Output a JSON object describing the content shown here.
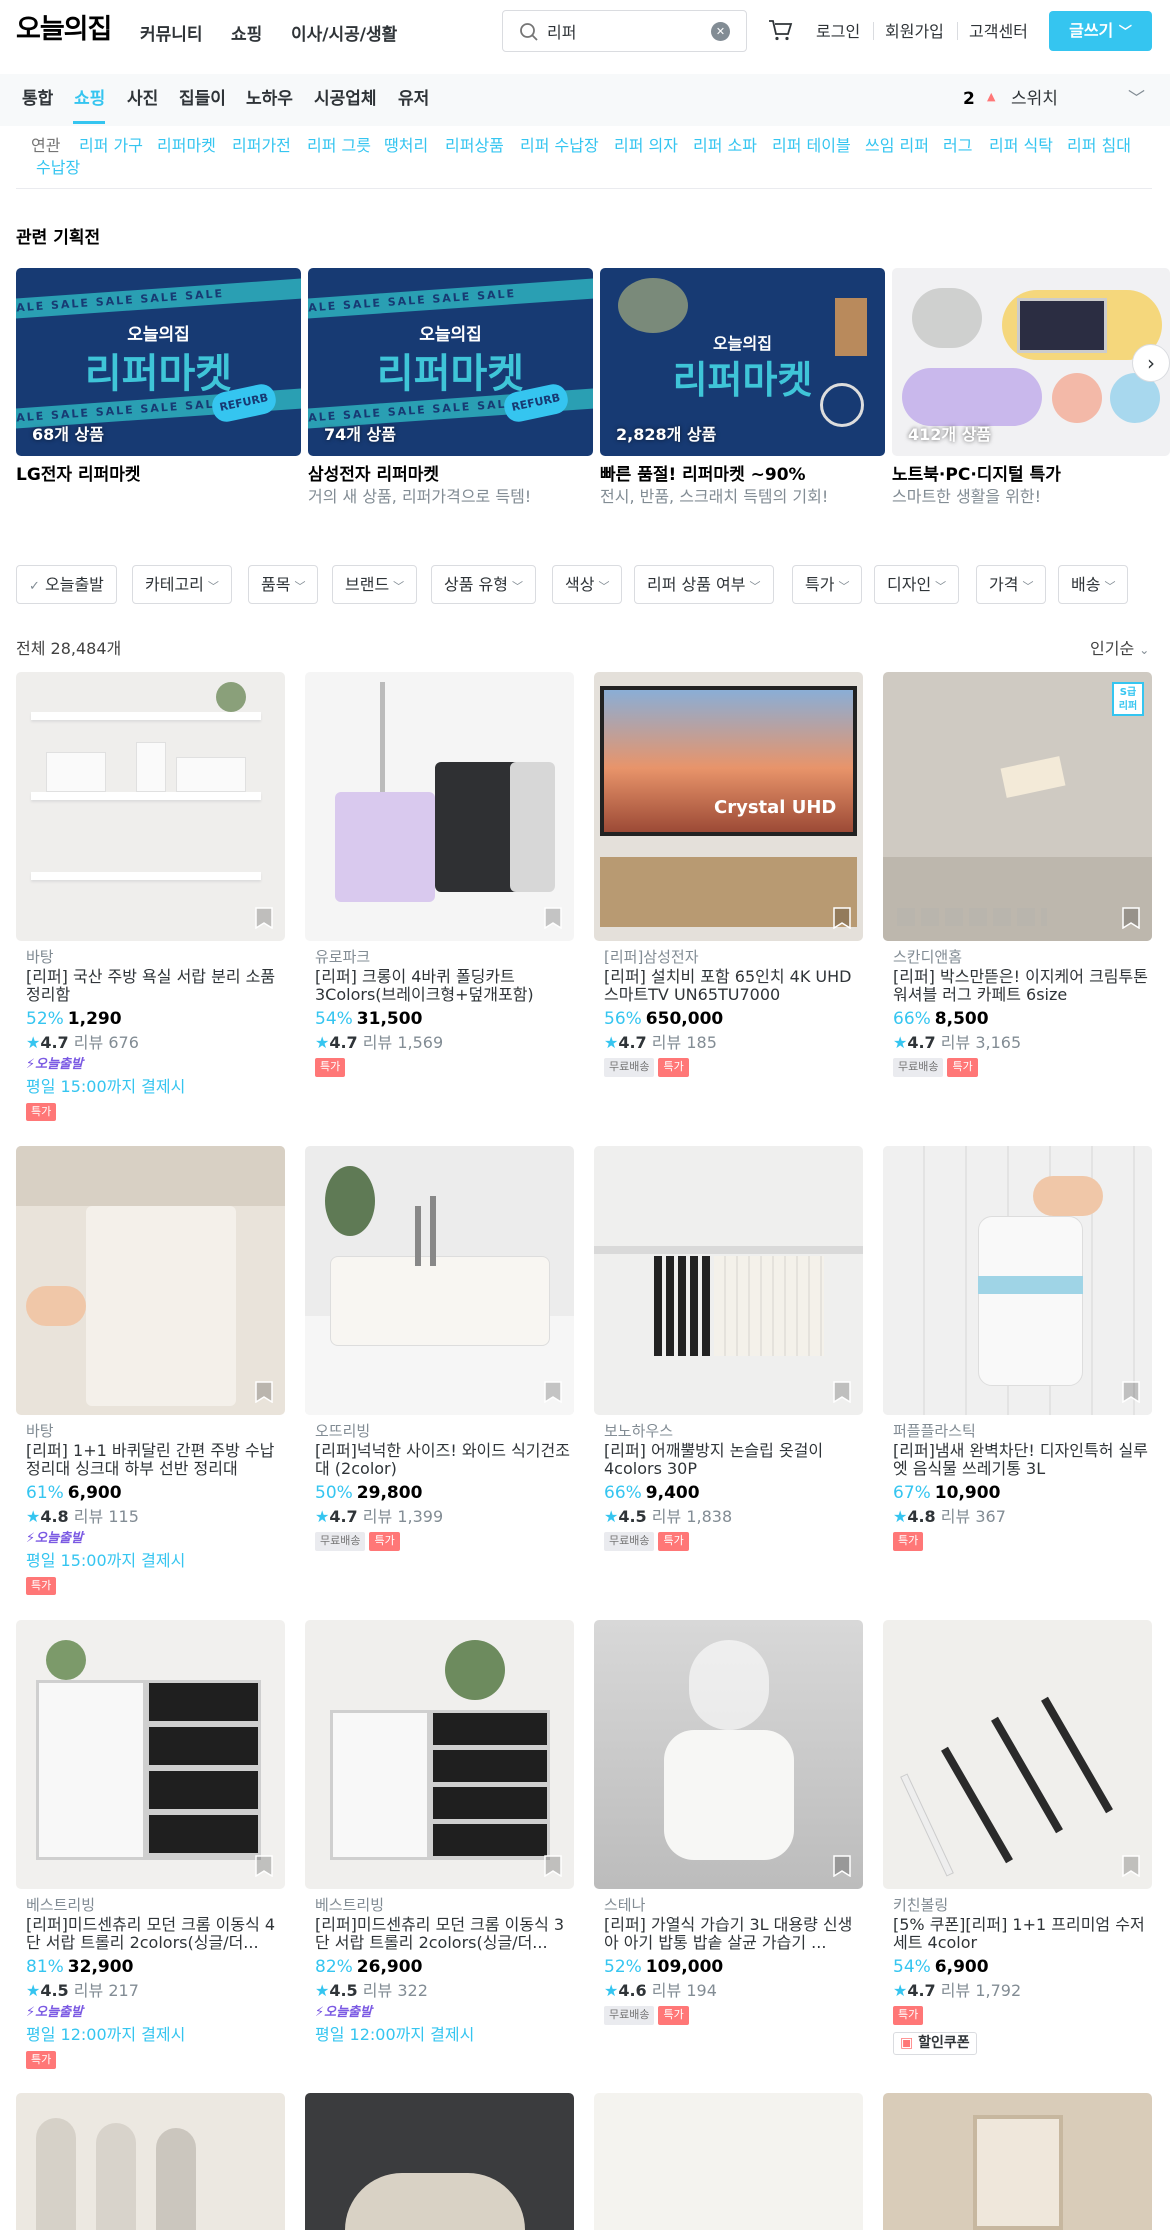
{
  "header": {
    "logo": "오늘의집",
    "nav": [
      "커뮤니티",
      "쇼핑",
      "이사/시공/생활"
    ],
    "search_value": "리퍼",
    "links": [
      "로그인",
      "회원가입",
      "고객센터"
    ],
    "write_button": "글쓰기"
  },
  "subnav": {
    "tabs": [
      "통합",
      "쇼핑",
      "사진",
      "집들이",
      "노하우",
      "시공업체",
      "유저"
    ],
    "active_tab": "쇼핑",
    "rank_number": "2",
    "rank_keyword": "스위치"
  },
  "related": {
    "label": "연관",
    "keywords": [
      "리퍼 가구",
      "리퍼마켓",
      "리퍼가전",
      "리퍼 그릇",
      "땡처리",
      "리퍼상품",
      "리퍼 수납장",
      "리퍼 의자",
      "리퍼 소파",
      "리퍼 테이블",
      "쓰임 리퍼",
      "러그",
      "리퍼 식탁",
      "리퍼 침대",
      "수납장"
    ]
  },
  "plans": {
    "title": "관련 기획전",
    "items": [
      {
        "count": "68개 상품",
        "title": "LG전자 리퍼마켓",
        "subtitle": "",
        "banner_brand": "오늘의집",
        "banner_title": "리퍼마켓",
        "banner_tag": "REFURB",
        "banner_strip": "SALE SALE SALE SALE SALE"
      },
      {
        "count": "74개 상품",
        "title": "삼성전자 리퍼마켓",
        "subtitle": "거의 새 상품, 리퍼가격으로 득템!",
        "banner_brand": "오늘의집",
        "banner_title": "리퍼마켓",
        "banner_tag": "REFURB",
        "banner_strip": "SALE SALE SALE SALE SALE"
      },
      {
        "count": "2,828개 상품",
        "title": "빠른 품절! 리퍼마켓 ~90%",
        "subtitle": "전시, 반품, 스크래치 득템의 기회!",
        "banner_brand": "오늘의집",
        "banner_title": "리퍼마켓"
      },
      {
        "count": "412개 상품",
        "title": "노트북·PC·디지털 특가",
        "subtitle": "스마트한 생활을 위한!"
      }
    ]
  },
  "filters": [
    "오늘출발",
    "카테고리",
    "품목",
    "브랜드",
    "상품 유형",
    "색상",
    "리퍼 상품 여부",
    "특가",
    "디자인",
    "가격",
    "배송"
  ],
  "results": {
    "total": "전체 28,484개",
    "sort": "인기순"
  },
  "labels": {
    "review": "리뷰",
    "today_ship": "오늘출발",
    "free_ship": "무료배송",
    "special": "특가",
    "coupon": "할인쿠폰",
    "img_tv_text": "Crystal UHD",
    "img_refurb_badge_1": "S급",
    "img_refurb_badge_2": "리퍼"
  },
  "products": [
    {
      "brand": "바탕",
      "name": "[리퍼] 국산 주방 욕실 서랍 분리 소품 정리함",
      "discount": "52%",
      "price": "1,290",
      "rating": "4.7",
      "reviews": "676",
      "today": true,
      "deadline": "평일 15:00까지 결제시",
      "free": false,
      "special": true
    },
    {
      "brand": "유로파크",
      "name": "[리퍼] 크롱이 4바퀴 폴딩카트 3Colors(브레이크형+덮개포함)",
      "discount": "54%",
      "price": "31,500",
      "rating": "4.7",
      "reviews": "1,569",
      "free": false,
      "special": true
    },
    {
      "brand": "[리퍼]삼성전자",
      "name": "[리퍼] 설치비 포함 65인치 4K UHD 스마트TV UN65TU7000",
      "discount": "56%",
      "price": "650,000",
      "rating": "4.7",
      "reviews": "185",
      "free": true,
      "special": true
    },
    {
      "brand": "스칸디앤홈",
      "name": "[리퍼] 박스만뜯은! 이지케어 크림투톤 워셔블 러그 카페트 6size",
      "discount": "66%",
      "price": "8,500",
      "rating": "4.7",
      "reviews": "3,165",
      "free": true,
      "special": true
    },
    {
      "brand": "바탕",
      "name": "[리퍼] 1+1 바퀴달린 간편 주방 수납정리대 싱크대 하부 선반 정리대",
      "discount": "61%",
      "price": "6,900",
      "rating": "4.8",
      "reviews": "115",
      "today": true,
      "deadline": "평일 15:00까지 결제시",
      "free": false,
      "special": true
    },
    {
      "brand": "오뜨리빙",
      "name": "[리퍼]넉넉한 사이즈! 와이드 식기건조대 (2color)",
      "discount": "50%",
      "price": "29,800",
      "rating": "4.7",
      "reviews": "1,399",
      "free": true,
      "special": true
    },
    {
      "brand": "보노하우스",
      "name": "[리퍼] 어깨뿔방지 논슬립 옷걸이 4colors 30P",
      "discount": "66%",
      "price": "9,400",
      "rating": "4.5",
      "reviews": "1,838",
      "free": true,
      "special": true
    },
    {
      "brand": "퍼플플라스틱",
      "name": "[리퍼]냄새 완벽차단! 디자인특허 실루엣 음식물 쓰레기통 3L",
      "discount": "67%",
      "price": "10,900",
      "rating": "4.8",
      "reviews": "367",
      "free": false,
      "special": true
    },
    {
      "brand": "베스트리빙",
      "name": "[리퍼]미드센츄리 모던 크롬 이동식 4단 서랍 트롤리 2colors(싱글/더...",
      "discount": "81%",
      "price": "32,900",
      "rating": "4.5",
      "reviews": "217",
      "today": true,
      "deadline": "평일 12:00까지 결제시",
      "free": false,
      "special": true
    },
    {
      "brand": "베스트리빙",
      "name": "[리퍼]미드센츄리 모던 크롬 이동식 3단 서랍 트롤리 2colors(싱글/더...",
      "discount": "82%",
      "price": "26,900",
      "rating": "4.5",
      "reviews": "322",
      "today": true,
      "deadline": "평일 12:00까지 결제시",
      "free": false,
      "special": false
    },
    {
      "brand": "스테나",
      "name": "[리퍼] 가열식 가습기 3L 대용량 신생아 아기 밥통 밥솥 살균 가습기 ...",
      "discount": "52%",
      "price": "109,000",
      "rating": "4.6",
      "reviews": "194",
      "free": true,
      "special": true
    },
    {
      "brand": "키친볼링",
      "name": "[5% 쿠폰][리퍼] 1+1 프리미엄 수저세트 4color",
      "discount": "54%",
      "price": "6,900",
      "rating": "4.7",
      "reviews": "1,792",
      "free": false,
      "special": true,
      "coupon": true
    }
  ],
  "colors": {
    "accent": "#35c5f0",
    "special": "#ff7777",
    "today": "#7b5ae3"
  }
}
